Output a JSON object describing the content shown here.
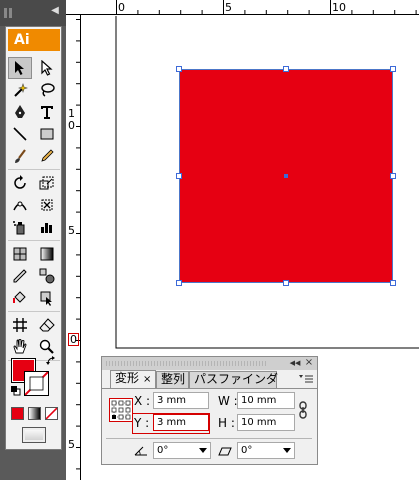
{
  "app": {
    "logo_text": "Ai"
  },
  "ruler": {
    "top_labels": [
      "0",
      "5",
      "10"
    ],
    "left_labels": [
      "1",
      "0",
      "5",
      "0",
      "5"
    ]
  },
  "transform_panel": {
    "tabs": [
      {
        "label": "変形",
        "active": true,
        "has_close": true
      },
      {
        "label": "整列",
        "active": false
      },
      {
        "label": "パスファインダ",
        "active": false
      }
    ],
    "x_label": "X :",
    "x_value": "3 mm",
    "y_label": "Y :",
    "y_value": "3 mm",
    "w_label": "W :",
    "w_value": "10 mm",
    "h_label": "H :",
    "h_value": "10 mm",
    "rotate_value": "0°",
    "shear_value": "0°",
    "close_symbol": "×",
    "collapse_symbol": "◀◀",
    "tab_close_symbol": "×"
  },
  "colors": {
    "fill": "#e60012",
    "stroke": "none",
    "selection": "#3d6ad8",
    "highlight": "#d40000"
  },
  "icons": [
    "selection-tool-icon",
    "direct-selection-tool-icon",
    "magic-wand-tool-icon",
    "lasso-tool-icon",
    "pen-tool-icon",
    "type-tool-icon",
    "line-segment-tool-icon",
    "rectangle-tool-icon",
    "paintbrush-tool-icon",
    "pencil-tool-icon",
    "rotate-tool-icon",
    "scale-tool-icon",
    "width-tool-icon",
    "free-transform-tool-icon",
    "symbol-sprayer-tool-icon",
    "column-graph-tool-icon",
    "mesh-tool-icon",
    "gradient-tool-icon",
    "eyedropper-tool-icon",
    "blend-tool-icon",
    "live-paint-bucket-tool-icon",
    "live-paint-selection-tool-icon",
    "artboard-tool-icon",
    "eraser-tool-icon",
    "hand-tool-icon",
    "zoom-tool-icon",
    "fill-swatch-icon",
    "stroke-swatch-icon",
    "swap-colors-icon",
    "default-colors-icon",
    "color-mode-icon",
    "gradient-mode-icon",
    "none-mode-icon",
    "screen-mode-icon",
    "link-proportions-icon",
    "panel-menu-icon",
    "reference-point-icon"
  ]
}
